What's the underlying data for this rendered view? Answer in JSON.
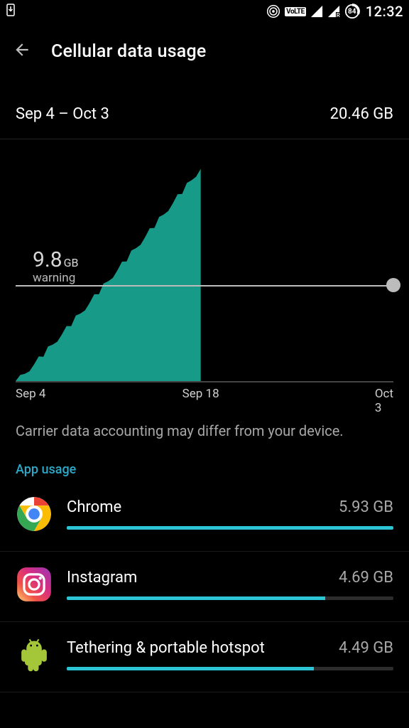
{
  "status": {
    "battery_percent": "84",
    "time": "12:32",
    "volte_label": "VoLTE"
  },
  "header": {
    "title": "Cellular data usage"
  },
  "cycle": {
    "range": "Sep 4 – Oct 3",
    "total": "20.46 GB"
  },
  "chart_data": {
    "type": "area",
    "xlabel": "",
    "ylabel": "",
    "x_ticks": [
      "Sep 4",
      "Sep 18",
      "Oct 3"
    ],
    "x_tick_positions_pct": [
      0,
      49,
      100
    ],
    "series": [
      {
        "name": "cumulative_usage_gb",
        "x_end_pct": 49,
        "y_max_gb": 20.46
      }
    ],
    "warning": {
      "value": "9.8",
      "unit": "GB",
      "label": "warning",
      "line_pct_from_top": 55
    }
  },
  "disclaimer": "Carrier data accounting may differ from your device.",
  "app_usage": {
    "title": "App usage",
    "max_gb": 5.93,
    "items": [
      {
        "name": "Chrome",
        "size": "5.93 GB",
        "gb": 5.93,
        "icon": "chrome"
      },
      {
        "name": "Instagram",
        "size": "4.69 GB",
        "gb": 4.69,
        "icon": "instagram"
      },
      {
        "name": "Tethering & portable hotspot",
        "size": "4.49 GB",
        "gb": 4.49,
        "icon": "android"
      }
    ]
  }
}
